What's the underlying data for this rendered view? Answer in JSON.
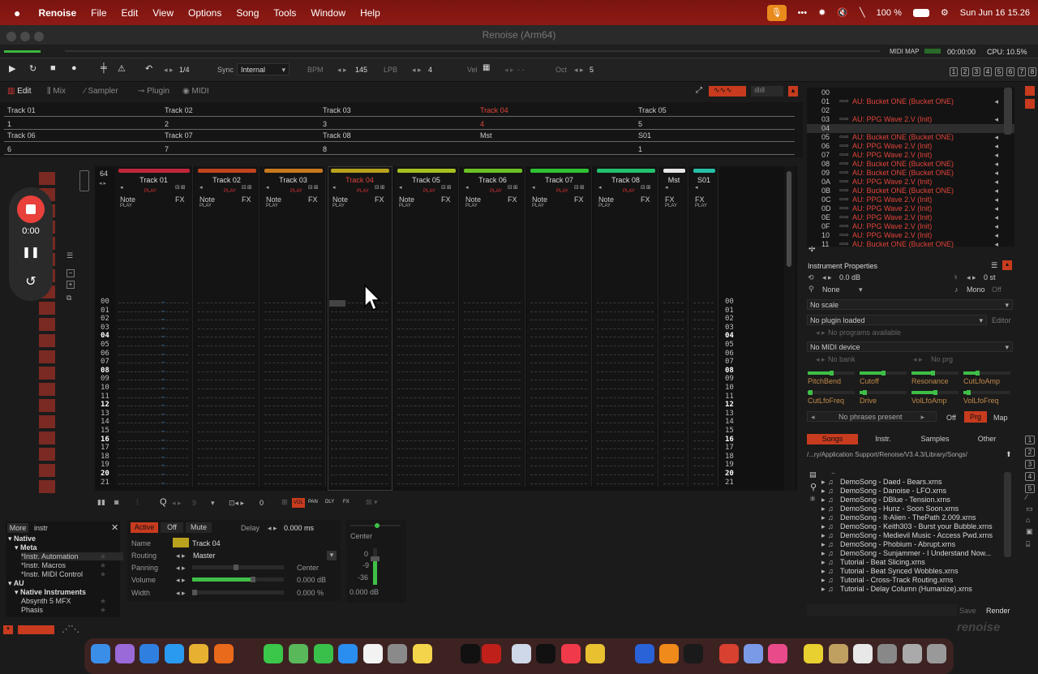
{
  "menubar": {
    "apple": "",
    "app": "Renoise",
    "items": [
      "File",
      "Edit",
      "View",
      "Options",
      "Song",
      "Tools",
      "Window",
      "Help"
    ],
    "battery": "100 %",
    "datetime": "Sun Jun 16  15.26"
  },
  "window": {
    "title": "Renoise (Arm64)"
  },
  "status": {
    "midi_map": "MIDI MAP",
    "time": "00:00:00",
    "cpu": "CPU: 10.5%"
  },
  "transport": {
    "quant": "1/4",
    "sync_label": "Sync",
    "sync_value": "Internal",
    "bpm_label": "BPM",
    "bpm": "145",
    "lpb_label": "LPB",
    "lpb": "4",
    "vel_label": "Vel",
    "vel": "- -",
    "oct_label": "Oct",
    "oct": "5",
    "layout_buttons": [
      "1",
      "2",
      "3",
      "4",
      "5",
      "6",
      "7",
      "8"
    ]
  },
  "tabs": [
    "Edit",
    "Mix",
    "Sampler",
    "Plugin",
    "MIDI"
  ],
  "track_table": {
    "row1_names": [
      "Track 01",
      "Track 02",
      "Track 03",
      "Track 04",
      "Track 05"
    ],
    "row1_values": [
      "1",
      "2",
      "3",
      "4",
      "5"
    ],
    "row2_names": [
      "Track 06",
      "Track 07",
      "Track 08",
      "Mst",
      "S01"
    ],
    "row2_values": [
      "6",
      "7",
      "8",
      "",
      "1"
    ]
  },
  "pattern": {
    "lines": "64",
    "tracks": [
      {
        "name": "Track 01",
        "color": "#c0263a"
      },
      {
        "name": "Track 02",
        "color": "#c2441f"
      },
      {
        "name": "Track 03",
        "color": "#c7791e"
      },
      {
        "name": "Track 04",
        "color": "#b9a21d"
      },
      {
        "name": "Track 05",
        "color": "#a6c11f"
      },
      {
        "name": "Track 06",
        "color": "#6cc224"
      },
      {
        "name": "Track 07",
        "color": "#2fc233"
      },
      {
        "name": "Track 08",
        "color": "#23c06e"
      },
      {
        "name": "Mst",
        "color": "#e6e6e6"
      },
      {
        "name": "S01",
        "color": "#27bfa8"
      }
    ],
    "note_label": "Note",
    "fx_label": "FX",
    "play_label": "PLAY",
    "rows": [
      "00",
      "01",
      "02",
      "03",
      "04",
      "05",
      "06",
      "07",
      "08",
      "09",
      "10",
      "11",
      "12",
      "13",
      "14",
      "15",
      "16",
      "17",
      "18",
      "19",
      "20",
      "21"
    ]
  },
  "recorder": {
    "time": "0:00"
  },
  "pattern_toolbar": {
    "step": "9",
    "pat": "0",
    "buttons": [
      "VOL",
      "PAN",
      "DLY",
      "FX"
    ]
  },
  "browser": {
    "more": "More",
    "search": "instr",
    "items": [
      {
        "label": "Native",
        "level": 0
      },
      {
        "label": "Meta",
        "level": 1
      },
      {
        "label": "*Instr. Automation",
        "level": 2
      },
      {
        "label": "*Instr. Macros",
        "level": 2
      },
      {
        "label": "*Instr. MIDI Control",
        "level": 2
      },
      {
        "label": "AU",
        "level": 0
      },
      {
        "label": "Native Instruments",
        "level": 1
      },
      {
        "label": "Absynth 5 MFX",
        "level": 2
      },
      {
        "label": "Phasis",
        "level": 2
      }
    ]
  },
  "track_props": {
    "active": "Active",
    "off": "Off",
    "mute": "Mute",
    "delay_label": "Delay",
    "delay": "0.000 ms",
    "name_label": "Name",
    "name": "Track 04",
    "routing_label": "Routing",
    "routing": "Master",
    "panning_label": "Panning",
    "panning": "Center",
    "volume_label": "Volume",
    "volume": "0.000 dB",
    "width_label": "Width",
    "width": "0.000 %"
  },
  "meter": {
    "pan": "Center",
    "m0": "0",
    "m9": "-9",
    "m36": "-36",
    "db": "0.000 dB"
  },
  "instruments": [
    {
      "n": "00",
      "t": ""
    },
    {
      "n": "01",
      "t": "AU: Bucket ONE (Bucket ONE)"
    },
    {
      "n": "02",
      "t": ""
    },
    {
      "n": "03",
      "t": "AU: PPG Wave 2.V (Init)"
    },
    {
      "n": "04",
      "t": ""
    },
    {
      "n": "05",
      "t": "AU: Bucket ONE (Bucket ONE)"
    },
    {
      "n": "06",
      "t": "AU: PPG Wave 2.V (Init)"
    },
    {
      "n": "07",
      "t": "AU: PPG Wave 2.V (Init)"
    },
    {
      "n": "08",
      "t": "AU: Bucket ONE (Bucket ONE)"
    },
    {
      "n": "09",
      "t": "AU: Bucket ONE (Bucket ONE)"
    },
    {
      "n": "0A",
      "t": "AU: PPG Wave 2.V (Init)"
    },
    {
      "n": "0B",
      "t": "AU: Bucket ONE (Bucket ONE)"
    },
    {
      "n": "0C",
      "t": "AU: PPG Wave 2.V (Init)"
    },
    {
      "n": "0D",
      "t": "AU: PPG Wave 2.V (Init)"
    },
    {
      "n": "0E",
      "t": "AU: PPG Wave 2.V (Init)"
    },
    {
      "n": "0F",
      "t": "AU: PPG Wave 2.V (Init)"
    },
    {
      "n": "10",
      "t": "AU: PPG Wave 2.V (Init)"
    },
    {
      "n": "11",
      "t": "AU: Bucket ONE (Bucket ONE)"
    }
  ],
  "inst_props": {
    "title": "Instrument Properties",
    "vol": "0.0 dB",
    "transpose": "0 st",
    "none": "None",
    "mono": "Mono",
    "off": "Off",
    "scale": "No scale",
    "plugin": "No plugin loaded",
    "editor": "Editor",
    "programs": "No programs available",
    "midi": "No MIDI device",
    "bank": "No bank",
    "prg": "No prg",
    "macros": [
      "PitchBend",
      "Cutoff",
      "Resonance",
      "CutLfoAmp",
      "CutLfoFreq",
      "Drive",
      "VolLfoAmp",
      "VolLfoFreq"
    ],
    "macro_levels": [
      0.5,
      0.5,
      0.45,
      0.3,
      0.05,
      0.1,
      0.5,
      0.1
    ],
    "phrases": "No phrases present",
    "ph_off": "Off",
    "ph_prg": "Prg",
    "ph_map": "Map"
  },
  "song_browser": {
    "tabs": [
      "Songs",
      "Instr.",
      "Samples",
      "Other"
    ],
    "path": "/...ry/Application Support/Renoise/V3.4.3/Library/Songs/",
    "files": [
      "DemoSong - Daed - Bears.xrns",
      "DemoSong - Danoise - LFO.xrns",
      "DemoSong - DBlue - Tension.xrns",
      "DemoSong - Hunz - Soon Soon.xrns",
      "DemoSong - It-Alien - ThePath 2.009.xrns",
      "DemoSong - Keith303 - Burst your Bubble.xrns",
      "DemoSong - Medievil Music - Access Pwd.xrns",
      "DemoSong - Phobium - Abrupt.xrns",
      "DemoSong - Sunjammer - I Understand Now...",
      "Tutorial - Beat Slicing.xrns",
      "Tutorial - Beat Synced Wobbles.xrns",
      "Tutorial - Cross-Track Routing.xrns",
      "Tutorial - Delay Column (Humanize).xrns"
    ],
    "save": "Save",
    "render": "Render"
  },
  "right_side_numbers": [
    "1",
    "2",
    "3",
    "4",
    "5"
  ],
  "logo": "renoise"
}
